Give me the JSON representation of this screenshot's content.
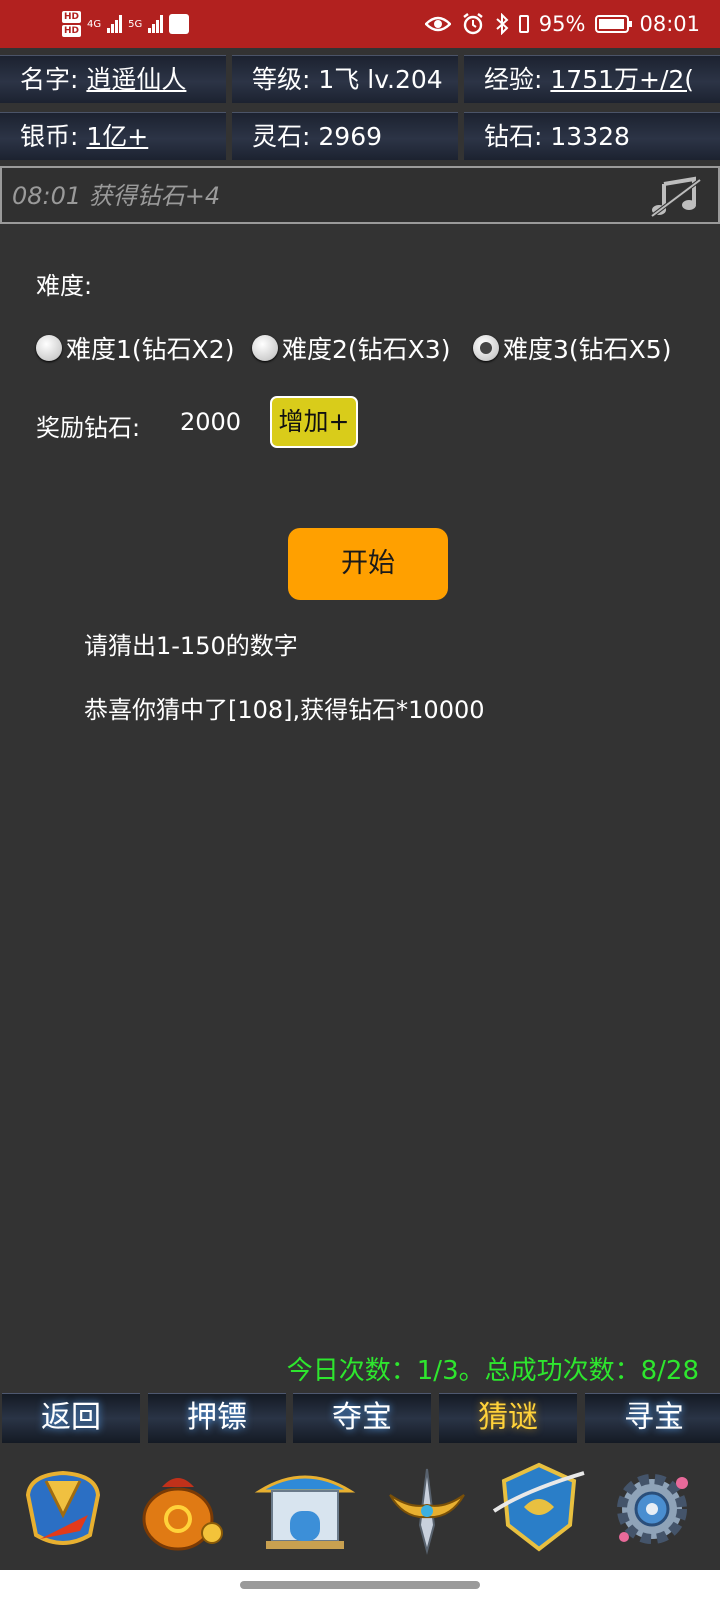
{
  "status_bar": {
    "hd1": "HD",
    "hd2": "HD",
    "net1": "4G",
    "net2": "5G",
    "battery_text": "95%",
    "battery_level": 0.95,
    "time": "08:01"
  },
  "player": {
    "name_label": "名字:",
    "name_value": "逍遥仙人",
    "level_label": "等级:",
    "level_value": "1飞 lv.204",
    "exp_label": "经验:",
    "exp_value": "1751万+/2(",
    "silver_label": "银币:",
    "silver_value": "1亿+",
    "spirit_label": "灵石:",
    "spirit_value": "2969",
    "diamond_label": "钻石:",
    "diamond_value": "13328"
  },
  "message": {
    "text": "08:01 获得钻石+4",
    "icon": "music-off-icon"
  },
  "game": {
    "difficulty_label": "难度:",
    "options": [
      {
        "label": "难度1(钻石X2)",
        "checked": false
      },
      {
        "label": "难度2(钻石X3)",
        "checked": false
      },
      {
        "label": "难度3(钻石X5)",
        "checked": true
      }
    ],
    "reward_label": "奖励钻石:",
    "reward_value": "2000",
    "add_button": "增加+",
    "start_button": "开始",
    "prompt": "请猜出1-150的数字",
    "result": "恭喜你猜中了[108],获得钻石*10000",
    "counts": "今日次数：1/3。总成功次数：8/28"
  },
  "tabs": [
    {
      "label": "返回",
      "active": false
    },
    {
      "label": "押镖",
      "active": false
    },
    {
      "label": "夺宝",
      "active": false
    },
    {
      "label": "猜谜",
      "active": true
    },
    {
      "label": "寻宝",
      "active": false
    }
  ],
  "game_icons": [
    "armor-icon",
    "treasure-bag-icon",
    "pavilion-icon",
    "sword-icon",
    "emblem-icon",
    "settings-gear-icon"
  ],
  "colors": {
    "status_bar": "#b2211f",
    "start_button": "#ffa000",
    "add_button": "#d9cc1a",
    "counts_text": "#2ee62e",
    "active_tab": "#ffd23a"
  }
}
